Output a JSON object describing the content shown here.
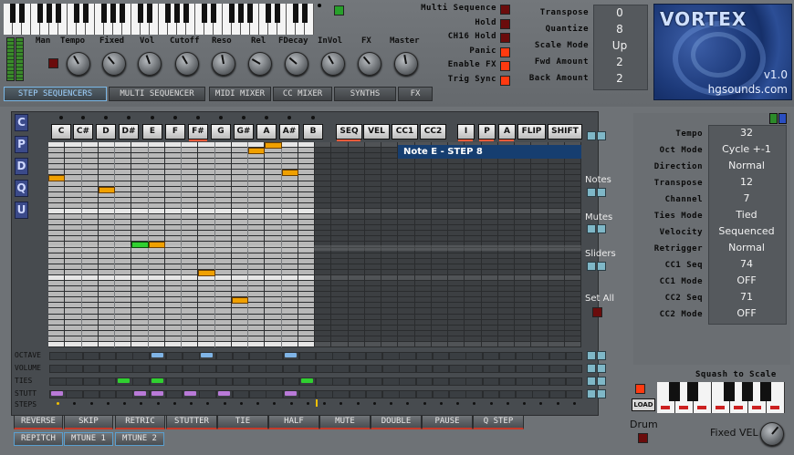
{
  "header": {
    "knobs": [
      {
        "label": "Man"
      },
      {
        "label": "Tempo"
      },
      {
        "label": "Fixed"
      },
      {
        "label": "Vol"
      },
      {
        "label": "Cutoff"
      },
      {
        "label": "Reso"
      },
      {
        "label": "Rel"
      },
      {
        "label": "FDecay"
      },
      {
        "label": "InVol"
      },
      {
        "label": "FX"
      },
      {
        "label": "Master"
      }
    ],
    "toggles": [
      "Multi Sequence",
      "Hold",
      "CH16 Hold",
      "Panic",
      "Enable FX",
      "Trig Sync"
    ],
    "settings": [
      {
        "label": "Transpose",
        "value": "0"
      },
      {
        "label": "Quantize",
        "value": "8"
      },
      {
        "label": "Scale Mode",
        "value": "Up"
      },
      {
        "label": "Fwd Amount",
        "value": "2"
      },
      {
        "label": "Back Amount",
        "value": "2"
      }
    ],
    "logo": {
      "title": "VORTEX",
      "version": "v1.0",
      "site": "hgsounds.com"
    }
  },
  "tabs": [
    "STEP SEQUENCERS",
    "MULTI SEQUENCER",
    "MIDI MIXER",
    "CC MIXER",
    "SYNTHS",
    "FX"
  ],
  "active_tab": "STEP SEQUENCERS",
  "side_letters": [
    "C",
    "P",
    "D",
    "Q",
    "U"
  ],
  "note_buttons": [
    "C",
    "C#",
    "D",
    "D#",
    "E",
    "F",
    "F#",
    "G",
    "G#",
    "A",
    "A#",
    "B"
  ],
  "mode_buttons": [
    "SEQ",
    "VEL",
    "CC1",
    "CC2"
  ],
  "extra_buttons": [
    "I",
    "P",
    "A",
    "FLIP",
    "SHIFT"
  ],
  "tooltip": "Note E  - STEP 8",
  "side_labels": [
    "Notes",
    "Mutes",
    "Sliders",
    "Set All"
  ],
  "lane_labels": [
    "OCTAVE",
    "VOLUME",
    "TIES",
    "STUTT",
    "STEPS"
  ],
  "bottom_buttons_row1": [
    "REVERSE",
    "SKIP",
    "RETRIC",
    "STUTTER",
    "TIE",
    "HALF",
    "MUTE",
    "DOUBLE",
    "PAUSE",
    "Q STEP"
  ],
  "bottom_buttons_row2": [
    "REPITCH",
    "MTUNE 1",
    "MTUNE 2"
  ],
  "params": [
    {
      "label": "Tempo",
      "value": "32"
    },
    {
      "label": "Oct Mode",
      "value": "Cycle +-1"
    },
    {
      "label": "Direction",
      "value": "Normal"
    },
    {
      "label": "Transpose",
      "value": "12"
    },
    {
      "label": "Channel",
      "value": "7"
    },
    {
      "label": "Ties Mode",
      "value": "Tied"
    },
    {
      "label": "Velocity",
      "value": "Sequenced"
    },
    {
      "label": "Retrigger",
      "value": "Normal"
    },
    {
      "label": "CC1 Seq",
      "value": "74"
    },
    {
      "label": "CC1 Mode",
      "value": "OFF"
    },
    {
      "label": "CC2 Seq",
      "value": "71"
    },
    {
      "label": "CC2 Mode",
      "value": "OFF"
    }
  ],
  "squash_label": "Squash to Scale",
  "load_label": "LOAD",
  "drum_label": "Drum",
  "fixed_vel_label": "Fixed VEL",
  "colors": {
    "accent_blue": "#7ab7e6",
    "note_orange": "#f0a000",
    "note_green": "#30d030",
    "led_red": "#ff3a10"
  }
}
